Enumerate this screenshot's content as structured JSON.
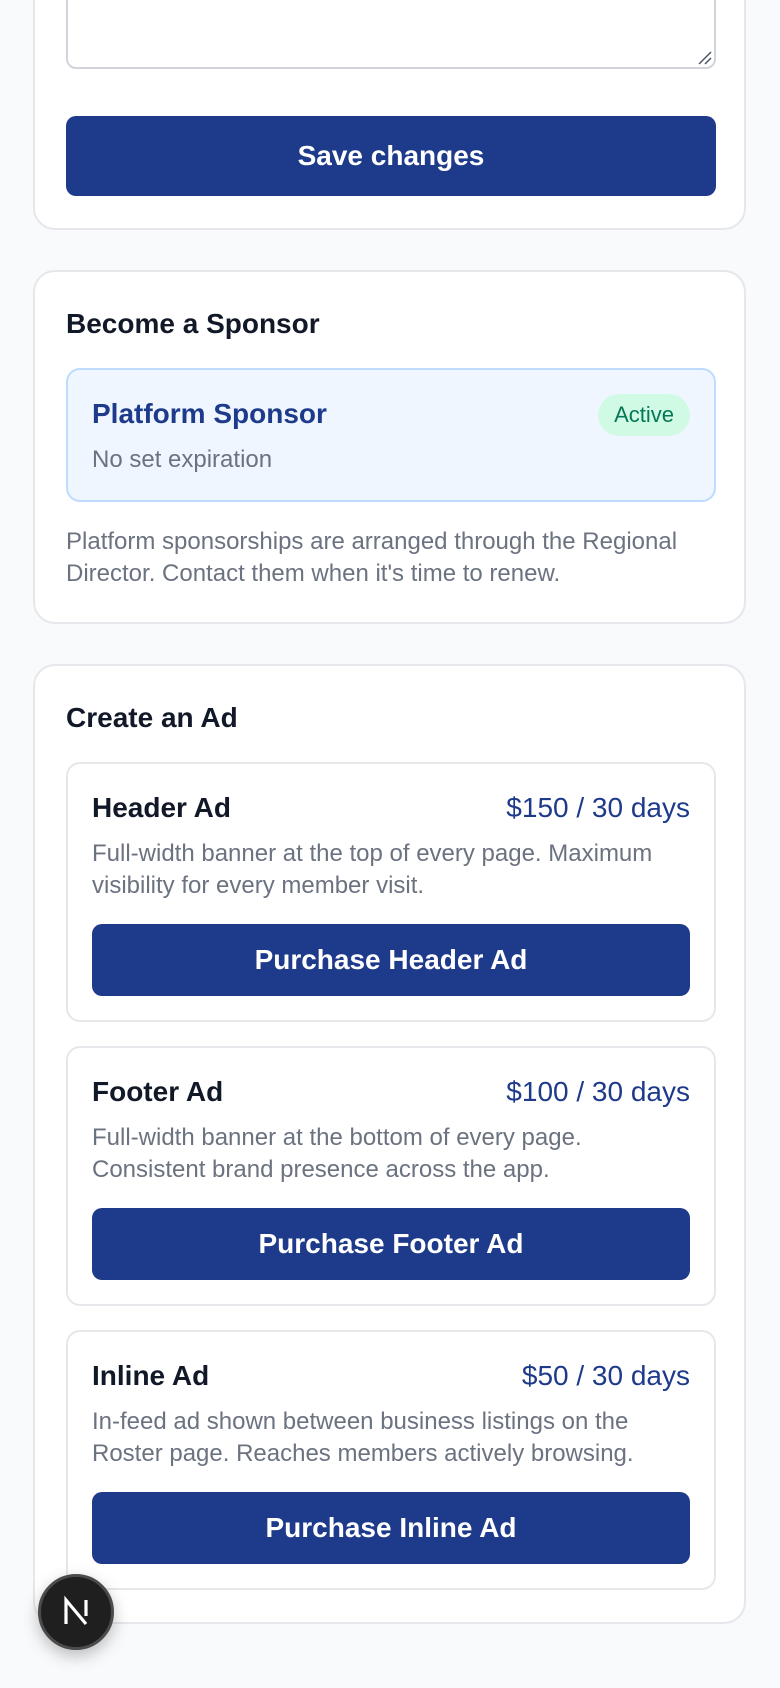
{
  "profile": {
    "save_label": "Save changes"
  },
  "sponsor": {
    "title": "Become a Sponsor",
    "plan": {
      "name": "Platform Sponsor",
      "expiry": "No set expiration",
      "status": "Active"
    },
    "note": "Platform sponsorships are arranged through the Regional Director. Contact them when it's time to renew."
  },
  "ads": {
    "title": "Create an Ad",
    "items": [
      {
        "name": "Header Ad",
        "price": "$150 / 30 days",
        "description": "Full-width banner at the top of every page. Maximum visibility for every member visit.",
        "button": "Purchase Header Ad"
      },
      {
        "name": "Footer Ad",
        "price": "$100 / 30 days",
        "description": "Full-width banner at the bottom of every page. Consistent brand presence across the app.",
        "button": "Purchase Footer Ad"
      },
      {
        "name": "Inline Ad",
        "price": "$50 / 30 days",
        "description": "In-feed ad shown between business listings on the Roster page. Reaches members actively browsing.",
        "button": "Purchase Inline Ad"
      }
    ]
  },
  "colors": {
    "primary": "#1e3a8a",
    "badge_bg": "#d1fae5",
    "badge_text": "#047857",
    "sponsor_bg": "#eff6ff"
  },
  "icons": {
    "dev_button": "next-logo-icon",
    "resize": "resize-grip-icon"
  }
}
